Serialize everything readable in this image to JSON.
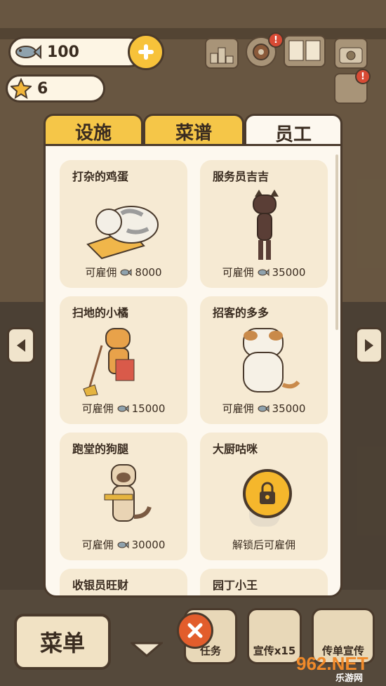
{
  "hud": {
    "fish_count": "100",
    "star_count": "6"
  },
  "tabs": [
    {
      "label": "设施",
      "active": false
    },
    {
      "label": "菜谱",
      "active": false
    },
    {
      "label": "员工",
      "active": true
    }
  ],
  "staff": [
    {
      "name": "打杂的鸡蛋",
      "price_label": "可雇佣",
      "price": "8000",
      "locked": false
    },
    {
      "name": "服务员吉吉",
      "price_label": "可雇佣",
      "price": "35000",
      "locked": false
    },
    {
      "name": "扫地的小橘",
      "price_label": "可雇佣",
      "price": "15000",
      "locked": false
    },
    {
      "name": "招客的多多",
      "price_label": "可雇佣",
      "price": "35000",
      "locked": false
    },
    {
      "name": "跑堂的狗腿",
      "price_label": "可雇佣",
      "price": "30000",
      "locked": false
    },
    {
      "name": "大厨咕咪",
      "price_label": "解锁后可雇佣",
      "price": "",
      "locked": true
    },
    {
      "name": "收银员旺财"
    },
    {
      "name": "园丁小王"
    }
  ],
  "bottom": {
    "menu_label": "菜单",
    "task_label": "任务",
    "promo_label": "宣传x15",
    "flyer_label": "传单宣传"
  },
  "watermark": {
    "text": "962.NET",
    "subtext": "乐游网"
  },
  "icons": [
    "fish-icon",
    "star-icon",
    "plus-icon",
    "ranking-icon",
    "settings-icon",
    "book-icon",
    "camera-icon",
    "lock-icon",
    "close-icon",
    "arrow-left-icon",
    "arrow-right-icon",
    "arrow-down-icon"
  ],
  "colors": {
    "tab_inactive": "#f5c648",
    "panel_bg": "#fdf8ef",
    "card_bg": "#f6ead3",
    "accent_orange": "#e25d2c",
    "badge_red": "#d84a34"
  }
}
